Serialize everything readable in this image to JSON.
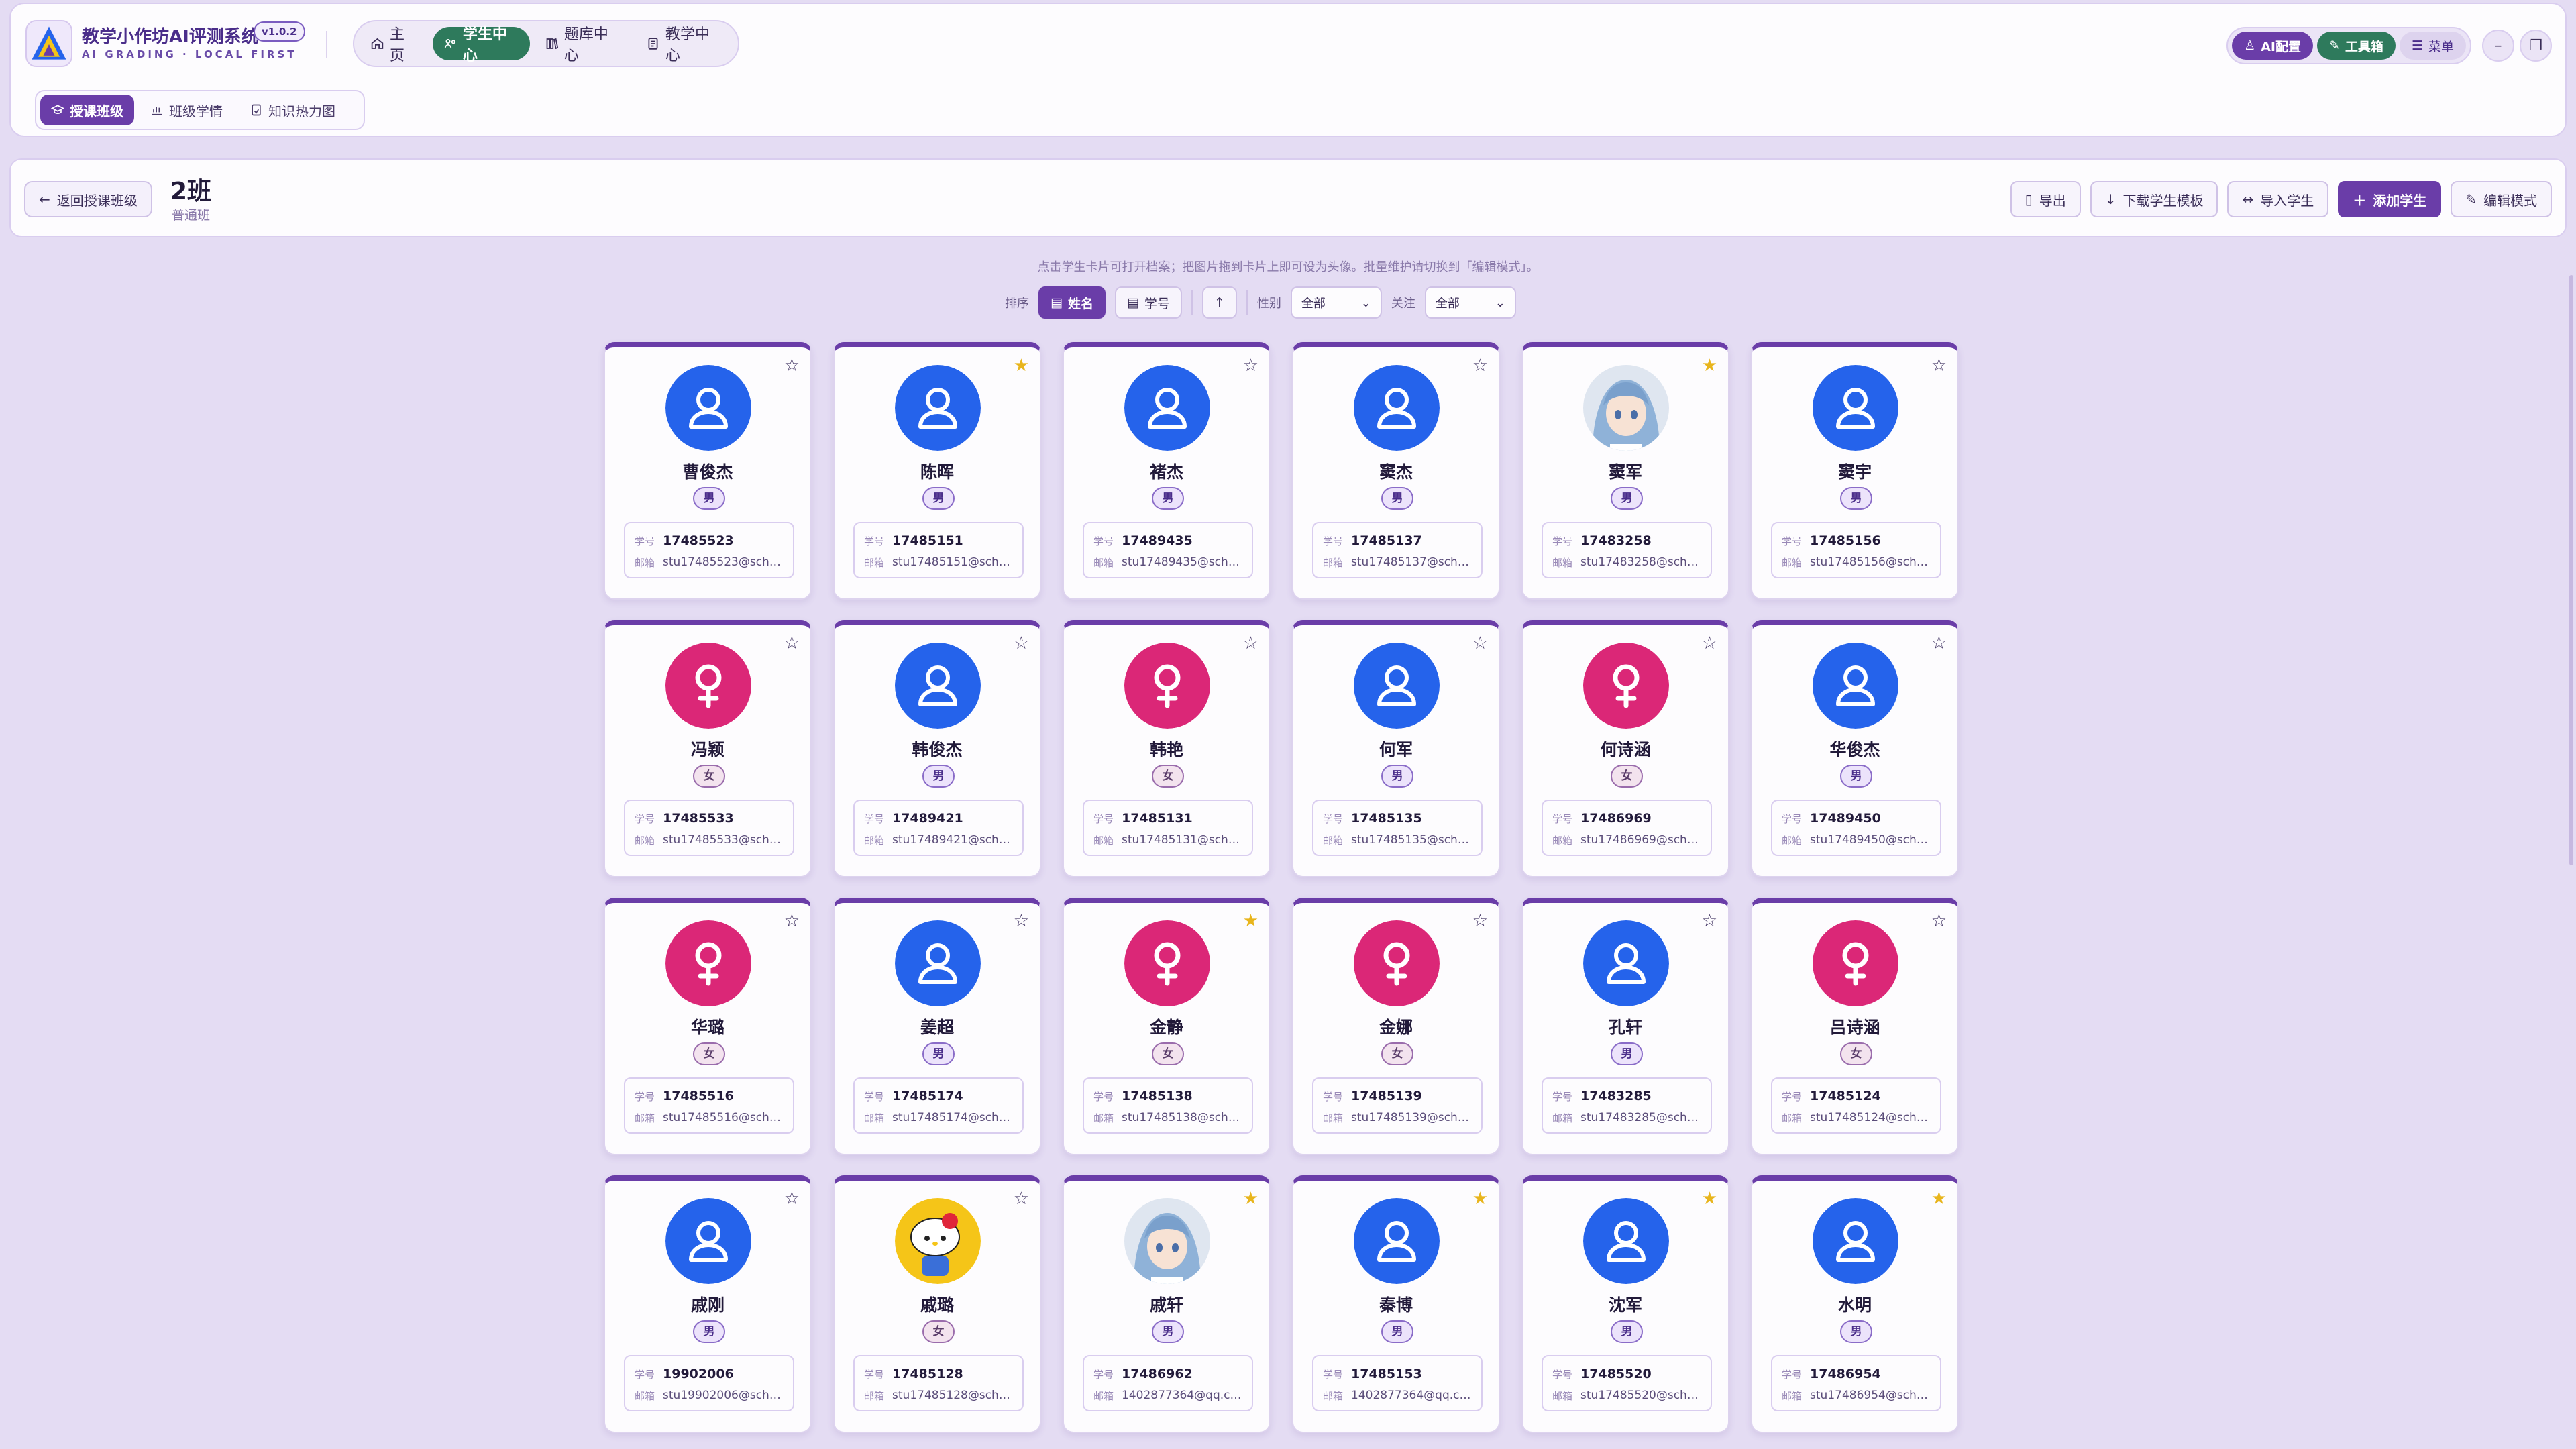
{
  "app": {
    "title": "教学小作坊AI评测系统",
    "subtitle": "AI GRADING · LOCAL FIRST",
    "version": "v1.0.2"
  },
  "nav": [
    {
      "label": "主页",
      "icon": "home-icon",
      "active": false
    },
    {
      "label": "学生中心",
      "icon": "students-icon",
      "active": true
    },
    {
      "label": "题库中心",
      "icon": "book-icon",
      "active": false
    },
    {
      "label": "教学中心",
      "icon": "document-icon",
      "active": false
    }
  ],
  "topright": {
    "ai": "AI配置",
    "tools": "工具箱",
    "menu": "菜单"
  },
  "subnav": [
    {
      "label": "授课班级",
      "icon": "graduation-cap-icon",
      "active": true
    },
    {
      "label": "班级学情",
      "icon": "chart-icon",
      "active": false
    },
    {
      "label": "知识热力图",
      "icon": "map-doc-icon",
      "active": false
    }
  ],
  "classbar": {
    "back": "返回授课班级",
    "name": "2班",
    "type": "普通班",
    "actions": {
      "export": "导出",
      "download_template": "下载学生模板",
      "import": "导入学生",
      "add": "添加学生",
      "edit_mode": "编辑模式"
    }
  },
  "hint": "点击学生卡片可打开档案；把图片拖到卡片上即可设为头像。批量维护请切换到「编辑模式」。",
  "filters": {
    "sort_label": "排序",
    "sort_name": "姓名",
    "sort_id": "学号",
    "gender_label": "性别",
    "gender_value": "全部",
    "follow_label": "关注",
    "follow_value": "全部"
  },
  "labels": {
    "id": "学号",
    "email": "邮箱"
  },
  "colors": {
    "accent": "#6a3da8",
    "green": "#2e7a5c",
    "male": "#2563eb",
    "female": "#db2777",
    "star": "#e8b51c"
  },
  "students": [
    {
      "name": "曹俊杰",
      "gender": "男",
      "id": "17485523",
      "email": "stu17485523@scho…",
      "star": false,
      "avatar": "male"
    },
    {
      "name": "陈晖",
      "gender": "男",
      "id": "17485151",
      "email": "stu17485151@schoo…",
      "star": true,
      "avatar": "male"
    },
    {
      "name": "褚杰",
      "gender": "男",
      "id": "17489435",
      "email": "stu17489435@scho…",
      "star": false,
      "avatar": "male"
    },
    {
      "name": "窦杰",
      "gender": "男",
      "id": "17485137",
      "email": "stu17485137@scho…",
      "star": false,
      "avatar": "male"
    },
    {
      "name": "窦军",
      "gender": "男",
      "id": "17483258",
      "email": "stu17483258@scho…",
      "star": true,
      "avatar": "anime"
    },
    {
      "name": "窦宇",
      "gender": "男",
      "id": "17485156",
      "email": "stu17485156@scho…",
      "star": false,
      "avatar": "male"
    },
    {
      "name": "冯颖",
      "gender": "女",
      "id": "17485533",
      "email": "stu17485533@scho…",
      "star": false,
      "avatar": "female"
    },
    {
      "name": "韩俊杰",
      "gender": "男",
      "id": "17489421",
      "email": "stu17489421@scho…",
      "star": false,
      "avatar": "male"
    },
    {
      "name": "韩艳",
      "gender": "女",
      "id": "17485131",
      "email": "stu17485131@scho…",
      "star": false,
      "avatar": "female"
    },
    {
      "name": "何军",
      "gender": "男",
      "id": "17485135",
      "email": "stu17485135@scho…",
      "star": false,
      "avatar": "male"
    },
    {
      "name": "何诗涵",
      "gender": "女",
      "id": "17486969",
      "email": "stu17486969@scho…",
      "star": false,
      "avatar": "female"
    },
    {
      "name": "华俊杰",
      "gender": "男",
      "id": "17489450",
      "email": "stu17489450@scho…",
      "star": false,
      "avatar": "male"
    },
    {
      "name": "华璐",
      "gender": "女",
      "id": "17485516",
      "email": "stu17485516@scho…",
      "star": false,
      "avatar": "female"
    },
    {
      "name": "姜超",
      "gender": "男",
      "id": "17485174",
      "email": "stu17485174@scho…",
      "star": false,
      "avatar": "male"
    },
    {
      "name": "金静",
      "gender": "女",
      "id": "17485138",
      "email": "stu17485138@scho…",
      "star": true,
      "avatar": "female"
    },
    {
      "name": "金娜",
      "gender": "女",
      "id": "17485139",
      "email": "stu17485139@scho…",
      "star": false,
      "avatar": "female"
    },
    {
      "name": "孔轩",
      "gender": "男",
      "id": "17483285",
      "email": "stu17483285@scho…",
      "star": false,
      "avatar": "male"
    },
    {
      "name": "吕诗涵",
      "gender": "女",
      "id": "17485124",
      "email": "stu17485124@scho…",
      "star": false,
      "avatar": "female"
    },
    {
      "name": "戚刚",
      "gender": "男",
      "id": "19902006",
      "email": "stu19902006@scho…",
      "star": false,
      "avatar": "male"
    },
    {
      "name": "戚璐",
      "gender": "女",
      "id": "17485128",
      "email": "stu17485128@scho…",
      "star": false,
      "avatar": "kitty"
    },
    {
      "name": "戚轩",
      "gender": "男",
      "id": "17486962",
      "email": "1402877364@qq.com",
      "star": true,
      "avatar": "anime"
    },
    {
      "name": "秦博",
      "gender": "男",
      "id": "17485153",
      "email": "1402877364@qq.com",
      "star": true,
      "avatar": "male"
    },
    {
      "name": "沈军",
      "gender": "男",
      "id": "17485520",
      "email": "stu17485520@scho…",
      "star": true,
      "avatar": "male"
    },
    {
      "name": "水明",
      "gender": "男",
      "id": "17486954",
      "email": "stu17486954@scho…",
      "star": true,
      "avatar": "male"
    }
  ]
}
